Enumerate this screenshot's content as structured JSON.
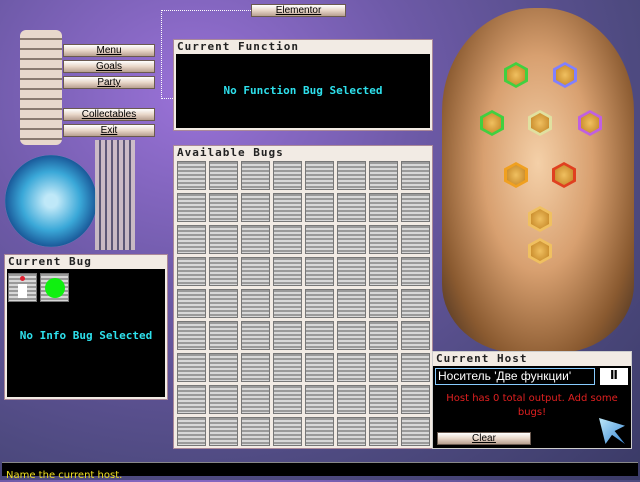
{
  "top_button": "Elementor",
  "menu": [
    "Menu",
    "Goals",
    "Party",
    "Collectables",
    "Exit"
  ],
  "current_function": {
    "title": "Current Function",
    "message": "No Function Bug Selected"
  },
  "available_bugs": {
    "title": "Available Bugs"
  },
  "current_bug": {
    "title": "Current Bug",
    "message": "No Info Bug Selected",
    "icons": [
      "trash-icon",
      "green-bug-icon"
    ]
  },
  "current_host": {
    "title": "Current Host",
    "name_value": "Носитель 'Две функции'",
    "message": "Host has 0 total output.  Add some bugs!",
    "clear_label": "Clear",
    "host_hex_colors": [
      "#40d040",
      "#8080ff",
      "#40d040",
      "#e0e0a0",
      "#c060e0",
      "#f0a020",
      "#e04020",
      "#f0c060",
      "#f0c060"
    ]
  },
  "status_bar": "Name the current host.",
  "colors": {
    "cyan_text": "#2ee0ec",
    "error_text": "#e02020"
  }
}
